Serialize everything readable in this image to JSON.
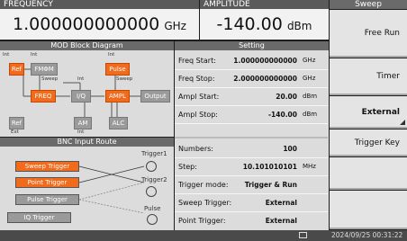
{
  "frequency": {
    "label": "FREQUENCY",
    "value": "1.000000000000",
    "unit": "GHz"
  },
  "amplitude": {
    "label": "AMPLITUDE",
    "value": "-140.00",
    "unit": "dBm"
  },
  "mod_diagram": {
    "title": "MOD Block Diagram",
    "ref": "Ref",
    "int1": "Int",
    "fm": "FMΦM",
    "int2": "Int",
    "pulse": "Pulse",
    "sweep1": "Sweep",
    "freq": "FREQ",
    "iq": "I/Q",
    "int3": "Int",
    "sweep2": "Sweep",
    "ampl": "AMPL",
    "output": "Output",
    "ref2": "Ref",
    "ext": "Ext",
    "am": "AM",
    "int4": "Int",
    "alc": "ALC"
  },
  "bnc": {
    "title": "BNC Input Route",
    "sweep_trigger": "Sweep Trigger",
    "point_trigger": "Point Trigger",
    "pulse_trigger": "Pulse Trigger",
    "iq_trigger": "IQ Trigger",
    "trigger1": "Trigger1",
    "trigger2": "Trigger2",
    "pulse": "Pulse"
  },
  "setting": {
    "title": "Setting",
    "freq_start": {
      "label": "Freq Start:",
      "value": "1.000000000000",
      "unit": "GHz"
    },
    "freq_stop": {
      "label": "Freq Stop:",
      "value": "2.000000000000",
      "unit": "GHz"
    },
    "ampl_start": {
      "label": "Ampl Start:",
      "value": "20.00",
      "unit": "dBm"
    },
    "ampl_stop": {
      "label": "Ampl Stop:",
      "value": "-140.00",
      "unit": "dBm"
    },
    "numbers": {
      "label": "Numbers:",
      "value": "100"
    },
    "step": {
      "label": "Step:",
      "value": "10.101010101",
      "unit": "MHz"
    },
    "trigger_mode": {
      "label": "Trigger mode:",
      "value": "Trigger & Run"
    },
    "sweep_trigger": {
      "label": "Sweep Trigger:",
      "value": "External"
    },
    "point_trigger": {
      "label": "Point Trigger:",
      "value": "External"
    }
  },
  "softkeys": {
    "title": "Sweep",
    "free_run": "Free Run",
    "timer": "Timer",
    "external": "External",
    "trigger_key": "Trigger Key"
  },
  "status": {
    "datetime": "2024/09/25 00:31:22"
  },
  "colors": {
    "accent": "#f26a1b",
    "header": "#5a5a5a"
  }
}
